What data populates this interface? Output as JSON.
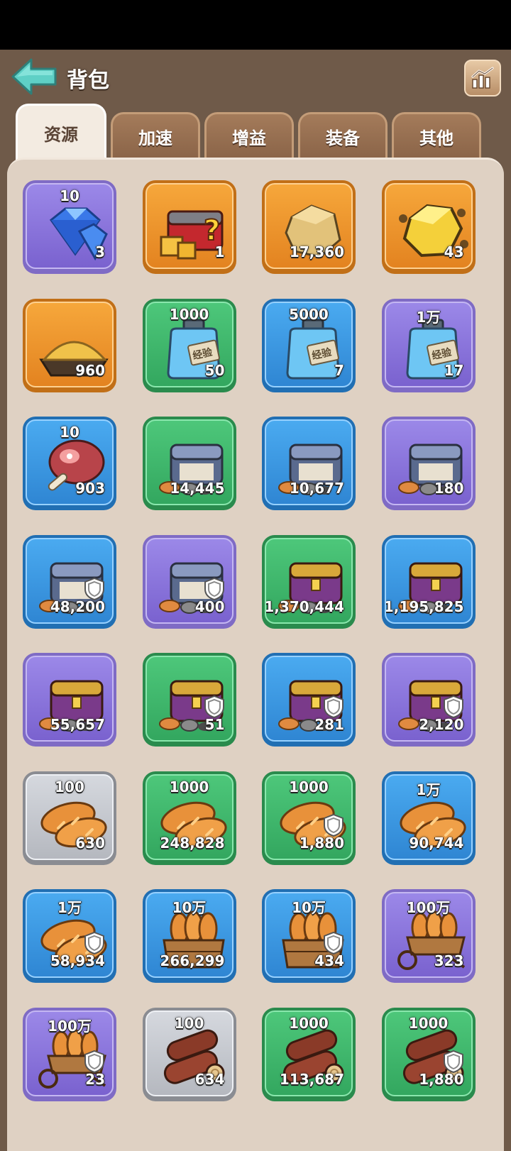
{
  "header": {
    "title": "背包"
  },
  "tabs": [
    {
      "label": "资源",
      "active": true
    },
    {
      "label": "加速",
      "active": false
    },
    {
      "label": "增益",
      "active": false
    },
    {
      "label": "装备",
      "active": false
    },
    {
      "label": "其他",
      "active": false
    }
  ],
  "items": [
    {
      "icon": "diamond-icon",
      "rarity": "purple",
      "label": "10",
      "count": "3",
      "shield": false
    },
    {
      "icon": "mystery-chest-icon",
      "rarity": "orange",
      "label": "",
      "count": "1",
      "shield": false
    },
    {
      "icon": "gold-ore-icon",
      "rarity": "orange",
      "label": "",
      "count": "17,360",
      "shield": false
    },
    {
      "icon": "gold-crystal-icon",
      "rarity": "orange",
      "label": "",
      "count": "43",
      "shield": false
    },
    {
      "icon": "gold-dust-icon",
      "rarity": "orange",
      "label": "",
      "count": "960",
      "shield": false
    },
    {
      "icon": "exp-potion-icon",
      "rarity": "green",
      "label": "1000",
      "count": "50",
      "shield": false
    },
    {
      "icon": "exp-potion-icon",
      "rarity": "blue",
      "label": "5000",
      "count": "7",
      "shield": false
    },
    {
      "icon": "exp-potion-icon",
      "rarity": "purple",
      "label": "1万",
      "count": "17",
      "shield": false
    },
    {
      "icon": "meat-icon",
      "rarity": "blue",
      "label": "10",
      "count": "903",
      "shield": false
    },
    {
      "icon": "silver-chest-icon",
      "rarity": "green",
      "label": "",
      "count": "14,445",
      "shield": false
    },
    {
      "icon": "silver-chest-icon",
      "rarity": "blue",
      "label": "",
      "count": "10,677",
      "shield": false
    },
    {
      "icon": "silver-chest-icon",
      "rarity": "purple",
      "label": "",
      "count": "180",
      "shield": false
    },
    {
      "icon": "silver-chest-icon",
      "rarity": "blue",
      "label": "",
      "count": "48,200",
      "shield": true
    },
    {
      "icon": "silver-chest-icon",
      "rarity": "purple",
      "label": "",
      "count": "400",
      "shield": true
    },
    {
      "icon": "gold-chest-icon",
      "rarity": "green",
      "label": "",
      "count": "1,370,444",
      "shield": false
    },
    {
      "icon": "gold-chest-icon",
      "rarity": "blue",
      "label": "",
      "count": "1,195,825",
      "shield": false
    },
    {
      "icon": "gold-chest-icon",
      "rarity": "purple",
      "label": "",
      "count": "55,657",
      "shield": false
    },
    {
      "icon": "gold-chest-icon",
      "rarity": "green",
      "label": "",
      "count": "51",
      "shield": true
    },
    {
      "icon": "gold-chest-icon",
      "rarity": "blue",
      "label": "",
      "count": "281",
      "shield": true
    },
    {
      "icon": "gold-chest-icon",
      "rarity": "purple",
      "label": "",
      "count": "2,120",
      "shield": true
    },
    {
      "icon": "bread-icon",
      "rarity": "gray",
      "label": "100",
      "count": "630",
      "shield": false
    },
    {
      "icon": "bread-icon",
      "rarity": "green",
      "label": "1000",
      "count": "248,828",
      "shield": false
    },
    {
      "icon": "bread-icon",
      "rarity": "green",
      "label": "1000",
      "count": "1,880",
      "shield": true
    },
    {
      "icon": "bread-icon",
      "rarity": "blue",
      "label": "1万",
      "count": "90,744",
      "shield": false
    },
    {
      "icon": "bread-icon",
      "rarity": "blue",
      "label": "1万",
      "count": "58,934",
      "shield": true
    },
    {
      "icon": "bread-crate-icon",
      "rarity": "blue",
      "label": "10万",
      "count": "266,299",
      "shield": false
    },
    {
      "icon": "bread-crate-icon",
      "rarity": "blue",
      "label": "10万",
      "count": "434",
      "shield": true
    },
    {
      "icon": "bread-cart-icon",
      "rarity": "purple",
      "label": "100万",
      "count": "323",
      "shield": false
    },
    {
      "icon": "bread-cart-icon",
      "rarity": "purple",
      "label": "100万",
      "count": "23",
      "shield": true
    },
    {
      "icon": "wood-log-icon",
      "rarity": "gray",
      "label": "100",
      "count": "634",
      "shield": false
    },
    {
      "icon": "wood-log-icon",
      "rarity": "green",
      "label": "1000",
      "count": "113,687",
      "shield": false
    },
    {
      "icon": "wood-log-icon",
      "rarity": "green",
      "label": "1000",
      "count": "1,880",
      "shield": true
    }
  ]
}
